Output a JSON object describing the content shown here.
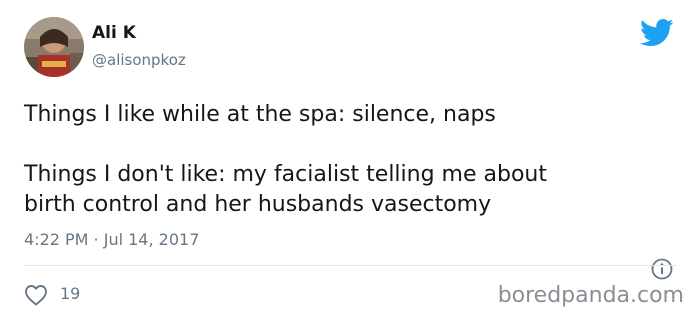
{
  "author": {
    "display_name": "Ali K",
    "handle": "@alisonpkoz",
    "avatar_icon": "profile-photo"
  },
  "brand": {
    "icon": "twitter-bird-icon",
    "color": "#1da1f2"
  },
  "tweet": {
    "line1": "Things I like while at the spa: silence, naps",
    "line2": "Things I don't like: my facialist telling me about",
    "line3": "birth control and her husbands vasectomy",
    "timestamp": "4:22 PM · Jul 14, 2017"
  },
  "actions": {
    "like_icon": "heart-icon",
    "like_count": "19",
    "info_icon": "info-icon"
  },
  "watermark": "boredpanda.com"
}
